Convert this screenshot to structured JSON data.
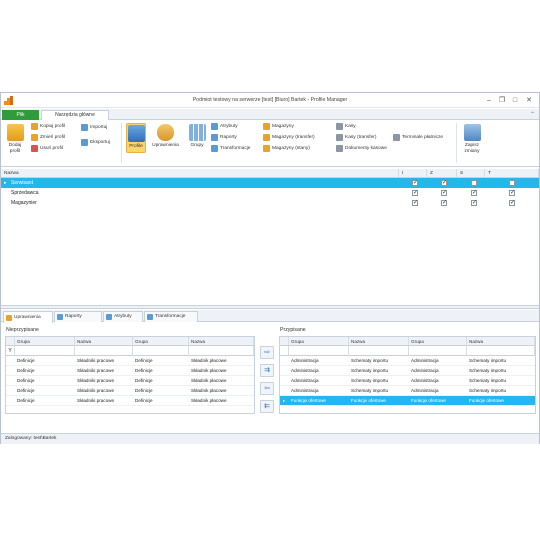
{
  "window": {
    "title": "Podmiot testowy na serwerze [test] [Biuro] Bartek - Profile Manager",
    "minimize": "–",
    "restore": "❐",
    "maximize": "□",
    "close": "✕"
  },
  "ribbon_tabs": {
    "file": "Plik",
    "main": "Narzędzia główne",
    "collapse": "⌃"
  },
  "ribbon": {
    "add_profile": "Dodaj profil",
    "copy_profile": "Kopiuj profil",
    "rename_profile": "Zmień profil",
    "delete_profile": "Usuń profil",
    "import": "Importuj",
    "export": "Eksportuj",
    "profile": "Profile",
    "permissions": "Uprawnienia",
    "groups": "Grupy",
    "attributes": "Atrybuty",
    "reports": "Raporty",
    "transformations": "Transformacje",
    "warehouses": "Magazyny",
    "warehouses_transfer": "Magazyny (transfer)",
    "warehouses_stock": "Magazyny (stany)",
    "cash": "Kasy",
    "cash_transfer": "Kasy (transfer)",
    "cash_docs": "Dokumenty kasowe",
    "terminals": "Terminale płatnicze",
    "save_changes": "Zapisz zmiany"
  },
  "top_grid": {
    "header_name": "Nazwa",
    "cols": [
      "I",
      "Z",
      "S",
      "T"
    ],
    "rows": [
      {
        "name": "Serwisant",
        "checks": [
          true,
          true,
          false,
          false
        ],
        "selected": true
      },
      {
        "name": "Sprzedawca",
        "checks": [
          true,
          true,
          true,
          true
        ],
        "selected": false
      },
      {
        "name": "Magazynier",
        "checks": [
          true,
          true,
          true,
          true
        ],
        "selected": false
      }
    ]
  },
  "bottom_tabs": [
    "Uprawnienia",
    "Raporty",
    "Atrybuty",
    "Transformacje"
  ],
  "left_panel": {
    "title": "Nieprzypisane",
    "headers": [
      "Grupa",
      "Nazwa",
      "Grupa",
      "Nazwa"
    ],
    "filter_icon": "Y",
    "rows": [
      [
        "Definicje",
        "Składniki pracowe",
        "Definicje",
        "Składnik płacowe"
      ],
      [
        "Definicje",
        "Składniki pracowe",
        "Definicje",
        "Składnik płacowe"
      ],
      [
        "Definicje",
        "Składniki pracowe",
        "Definicje",
        "Składnik płacowe"
      ],
      [
        "Definicje",
        "Składniki pracowe",
        "Definicje",
        "Składnik płacowe"
      ],
      [
        "Definicje",
        "Składniki pracowe",
        "Definicje",
        "Składnik płacowe"
      ]
    ]
  },
  "right_panel": {
    "title": "Przypisane",
    "headers": [
      "Grupa",
      "Nazwa",
      "Grupa",
      "Nazwa"
    ],
    "rows": [
      {
        "cells": [
          "Administracja",
          "Schematy importu",
          "Administracja",
          "Schematy importu"
        ],
        "selected": false
      },
      {
        "cells": [
          "Administracja",
          "Schematy importu",
          "Administracja",
          "Schematy importu"
        ],
        "selected": false
      },
      {
        "cells": [
          "Administracja",
          "Schematy importu",
          "Administracja",
          "Schematy importu"
        ],
        "selected": false
      },
      {
        "cells": [
          "Administracja",
          "Schematy importu",
          "Administracja",
          "Schematy importu"
        ],
        "selected": false
      },
      {
        "cells": [
          "Funkcje ofertowe",
          "Funkcje ofertowe",
          "Funkcje ofertowe",
          "Funkcje ofertowe"
        ],
        "selected": true
      }
    ]
  },
  "move_buttons": [
    "⇨",
    "⇉",
    "⇦",
    "⇇"
  ],
  "status": {
    "text": "Zalogowany: test\\Bartek"
  }
}
